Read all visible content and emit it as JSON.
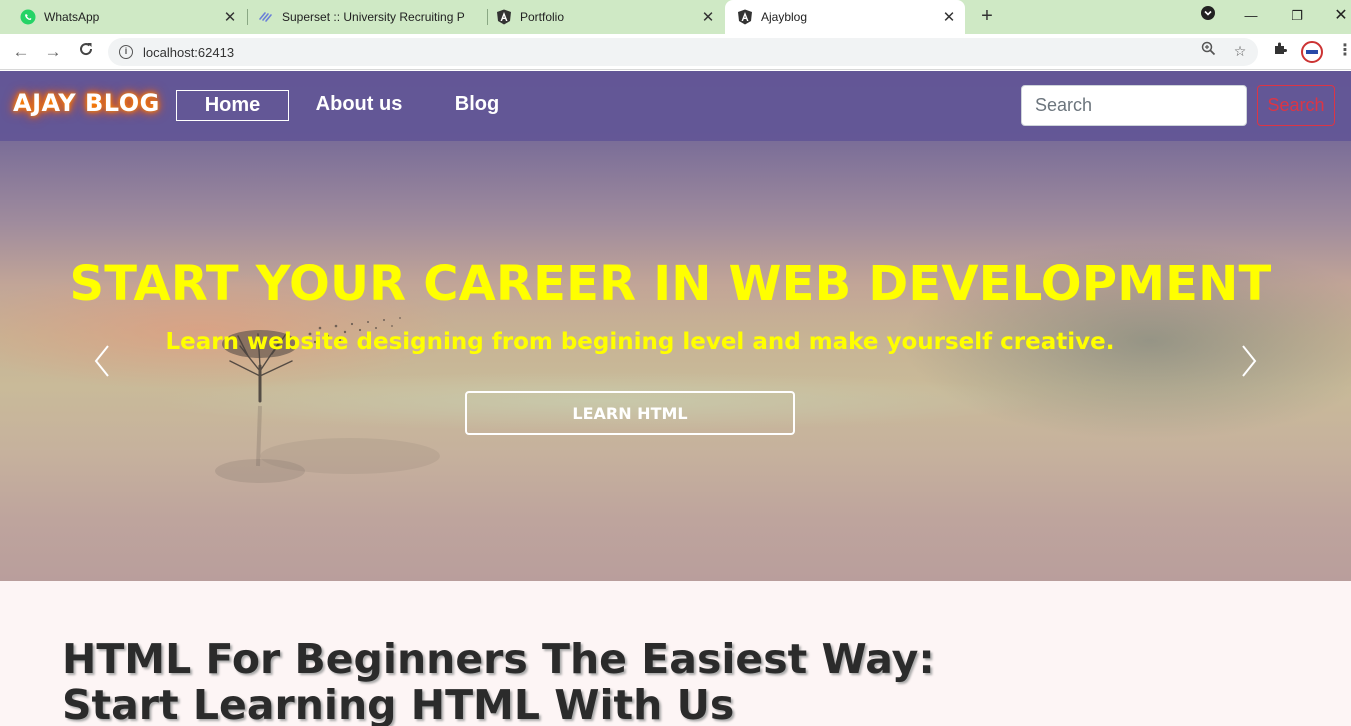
{
  "browser": {
    "tabs": [
      {
        "title": "WhatsApp",
        "icon": "whatsapp-icon",
        "active": false
      },
      {
        "title": "Superset :: University Recruiting P",
        "icon": "superset-icon",
        "active": false
      },
      {
        "title": "Portfolio",
        "icon": "angular-icon",
        "active": false
      },
      {
        "title": "Ajayblog",
        "icon": "angular-icon",
        "active": true
      }
    ],
    "url": "localhost:62413"
  },
  "site": {
    "brand": "AJAY BLOG",
    "nav": {
      "home": "Home",
      "about": "About us",
      "blog": "Blog"
    },
    "search": {
      "placeholder": "Search",
      "button": "Search"
    }
  },
  "hero": {
    "title": "START YOUR CAREER IN WEB DEVELOPMENT",
    "subtitle": "Learn website designing from begining level and make yourself creative.",
    "cta": "LEARN HTML"
  },
  "article": {
    "title_line1": "HTML For Beginners The Easiest Way:",
    "title_line2": "Start Learning HTML With Us"
  },
  "colors": {
    "hero_text": "#ffff00",
    "navbar": "#6b5e98",
    "search_button": "#dc3545",
    "tabstrip": "#cfe9c5"
  }
}
